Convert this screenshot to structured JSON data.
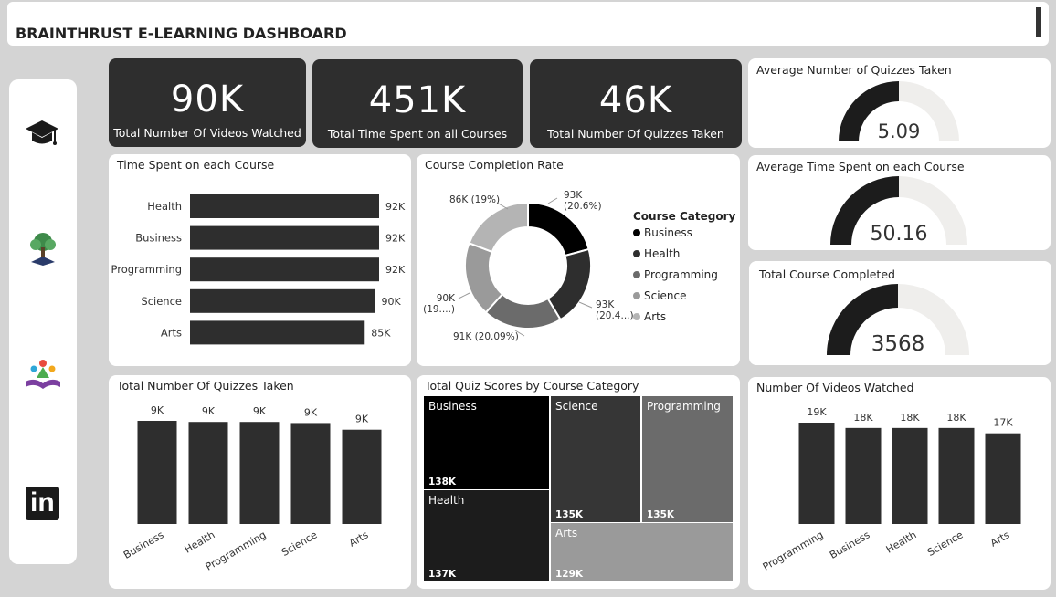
{
  "header": {
    "title": "BRAINTHRUST E-LEARNING DASHBOARD"
  },
  "sidebar": {
    "icons": [
      "graduation-cap-icon",
      "tree-icon",
      "kids-reading-icon",
      "linkedin-icon"
    ],
    "linkedin_text": "in"
  },
  "kpis": [
    {
      "value": "90K",
      "label": "Total Number Of Videos Watched"
    },
    {
      "value": "451K",
      "label": "Total Time Spent on all Courses"
    },
    {
      "value": "46K",
      "label": "Total Number Of Quizzes Taken"
    }
  ],
  "gauges": [
    {
      "title": "Average Number of Quizzes Taken",
      "value": "5.09",
      "fill": 0.5
    },
    {
      "title": "Average Time Spent on each Course",
      "value": "50.16",
      "fill": 0.5
    },
    {
      "title": "Total Course Completed",
      "value": "3568",
      "fill": 0.5
    }
  ],
  "colors": {
    "black": "#000000",
    "dark": "#2e2e2e",
    "mid": "#6b6b6b",
    "light": "#9a9a9a",
    "lighter": "#b4b4b4",
    "gauge_bg": "#efeeec",
    "gauge_fill": "#1c1c1c"
  },
  "time_spent": {
    "title": "Time Spent on each Course",
    "chart_data": {
      "type": "bar",
      "orientation": "horizontal",
      "categories": [
        "Health",
        "Business",
        "Programming",
        "Science",
        "Arts"
      ],
      "values": [
        92,
        92,
        92,
        90,
        85
      ],
      "labels": [
        "92K",
        "92K",
        "92K",
        "90K",
        "85K"
      ]
    }
  },
  "completion": {
    "title": "Course Completion Rate",
    "legend_title": "Course Category",
    "chart_data": {
      "type": "pie",
      "donut": true,
      "categories": [
        "Business",
        "Health",
        "Programming",
        "Science",
        "Arts"
      ],
      "values": [
        20.6,
        20.4,
        20.09,
        19.0,
        19.0
      ],
      "labels": [
        [
          "93K",
          "(20.6%)"
        ],
        [
          "93K",
          "(20.4...)"
        ],
        [
          "91K (20.09%)"
        ],
        [
          "90K",
          "(19....)"
        ],
        [
          "86K (19%)"
        ]
      ]
    }
  },
  "quizzes": {
    "title": "Total Number Of Quizzes Taken",
    "chart_data": {
      "type": "bar",
      "categories": [
        "Business",
        "Health",
        "Programming",
        "Science",
        "Arts"
      ],
      "values": [
        9.3,
        9.2,
        9.2,
        9.1,
        8.5
      ],
      "labels": [
        "9K",
        "9K",
        "9K",
        "9K",
        "9K"
      ]
    }
  },
  "quiz_scores": {
    "title": "Total Quiz Scores by Course Category",
    "chart_data": {
      "type": "treemap",
      "categories": [
        "Business",
        "Health",
        "Science",
        "Programming",
        "Arts"
      ],
      "values": [
        138,
        137,
        135,
        135,
        129
      ],
      "labels": [
        "138K",
        "137K",
        "135K",
        "135K",
        "129K"
      ]
    }
  },
  "videos": {
    "title": "Number Of Videos Watched",
    "chart_data": {
      "type": "bar",
      "categories": [
        "Programming",
        "Business",
        "Health",
        "Science",
        "Arts"
      ],
      "values": [
        19,
        18,
        18,
        18,
        17
      ],
      "labels": [
        "19K",
        "18K",
        "18K",
        "18K",
        "17K"
      ]
    }
  }
}
